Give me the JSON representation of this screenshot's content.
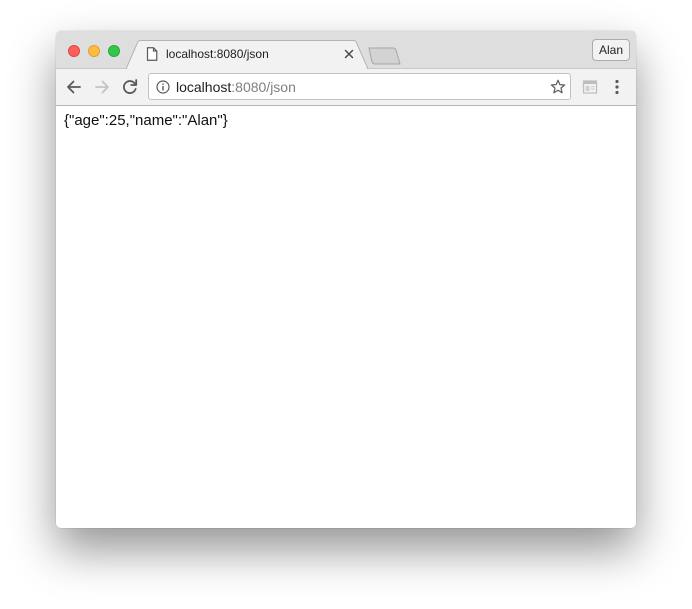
{
  "window": {
    "traffic_lights": {
      "close": "#fc605c",
      "minimize": "#fdbc40",
      "maximize": "#34c84a"
    }
  },
  "tabs": [
    {
      "title": "localhost:8080/json",
      "icon": "document-icon",
      "active": true
    }
  ],
  "new_tab_icon": "new-tab-icon",
  "profile": {
    "name": "Alan"
  },
  "toolbar": {
    "back_icon": "arrow-left-icon",
    "forward_icon": "arrow-right-icon",
    "forward_enabled": false,
    "reload_icon": "reload-icon",
    "site_info_icon": "info-icon",
    "url_host": "localhost",
    "url_rest": ":8080/json",
    "bookmark_icon": "star-icon",
    "extension_icon": "reader-mode-icon",
    "menu_icon": "kebab-menu-icon"
  },
  "page": {
    "body_text": "{\"age\":25,\"name\":\"Alan\"}"
  },
  "colors": {
    "titlebar": "#dedede",
    "toolbar": "#f2f2f2",
    "active_tab": "#f2f2f2"
  }
}
